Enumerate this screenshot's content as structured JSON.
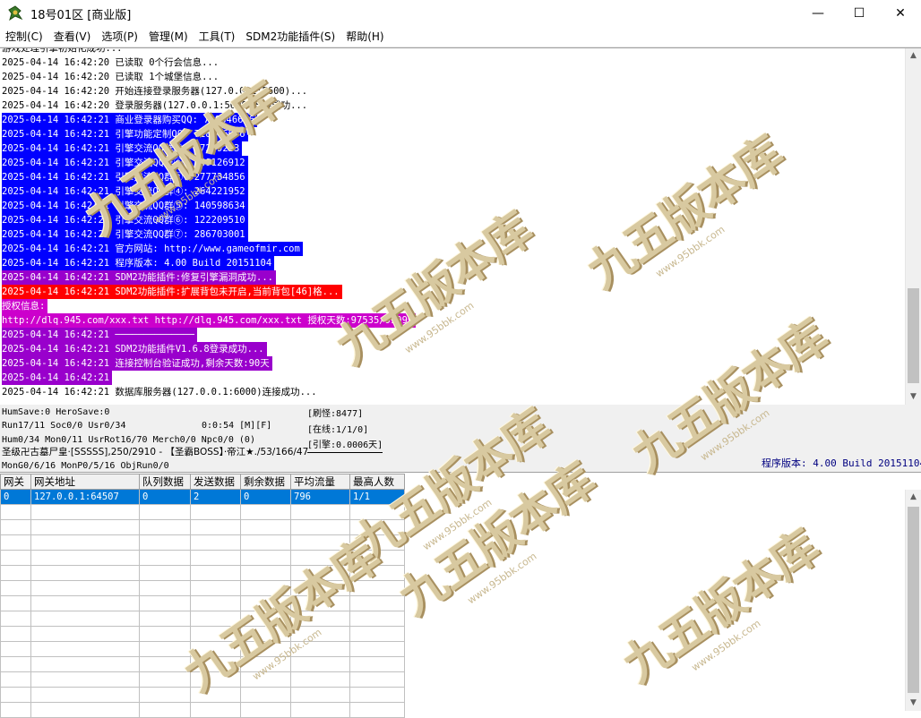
{
  "window": {
    "title": "18号01区 [商业版]",
    "controls": {
      "minimize": "—",
      "maximize": "☐",
      "close": "✕"
    }
  },
  "menu": [
    "控制(C)",
    "查看(V)",
    "选项(P)",
    "管理(M)",
    "工具(T)",
    "SDM2功能插件(S)",
    "帮助(H)"
  ],
  "log": {
    "lines": [
      {
        "text": "游戏处理引擎初始化成功...",
        "bg": ""
      },
      {
        "text": "2025-04-14 16:42:20 已读取 0个行会信息...",
        "bg": ""
      },
      {
        "text": "2025-04-14 16:42:20 已读取 1个城堡信息...",
        "bg": ""
      },
      {
        "text": "2025-04-14 16:42:20 开始连接登录服务器(127.0.0.1:5600)...",
        "bg": ""
      },
      {
        "text": "2025-04-14 16:42:20 登录服务器(127.0.0.1:5600)连接成功...",
        "bg": ""
      },
      {
        "text": "2025-04-14 16:42:21 商业登录器购买QQ: 718846686",
        "bg": "#0000ff"
      },
      {
        "text": "2025-04-14 16:42:21 引擎功能定制QQ: 718846686",
        "bg": "#0000ff"
      },
      {
        "text": "2025-04-14 16:42:21 引擎交流QQ群①: 27299223",
        "bg": "#0000ff"
      },
      {
        "text": "2025-04-14 16:42:21 引擎交流QQ群②: 249126912",
        "bg": "#0000ff"
      },
      {
        "text": "2025-04-14 16:42:21 引擎交流QQ群③: 277734856",
        "bg": "#0000ff"
      },
      {
        "text": "2025-04-14 16:42:21 引擎交流QQ群④: 264221952",
        "bg": "#0000ff"
      },
      {
        "text": "2025-04-14 16:42:21 引擎交流QQ群⑤: 140598634",
        "bg": "#0000ff"
      },
      {
        "text": "2025-04-14 16:42:21 引擎交流QQ群⑥: 122209510",
        "bg": "#0000ff"
      },
      {
        "text": "2025-04-14 16:42:21 引擎交流QQ群⑦: 286703001",
        "bg": "#0000ff"
      },
      {
        "text": "2025-04-14 16:42:21 官方网站: http://www.gameofmir.com",
        "bg": "#0000ff"
      },
      {
        "text": "2025-04-14 16:42:21 程序版本: 4.00 Build 20151104",
        "bg": "#0000ff"
      },
      {
        "text": "2025-04-14 16:42:21 SDM2功能插件:修复引擎漏洞成功...",
        "bg": "#9900cc"
      },
      {
        "text": "2025-04-14 16:42:21 SDM2功能插件:扩展背包未开启,当前背包[46]格...",
        "bg": "#ff0000"
      },
      {
        "text": "授权信息:",
        "bg": "#cc00cc"
      },
      {
        "text": "http://dlq.945.com/xxx.txt http://dlq.945.com/xxx.txt 授权天数:97535/99999",
        "bg": "#cc00cc"
      },
      {
        "text": "2025-04-14 16:42:21 ──────────────",
        "bg": "#9900cc"
      },
      {
        "text": "2025-04-14 16:42:21 SDM2功能插件V1.6.8登录成功...",
        "bg": "#9900cc"
      },
      {
        "text": "2025-04-14 16:42:21 连接控制台验证成功,剩余天数:90天",
        "bg": "#9900cc"
      },
      {
        "text": "2025-04-14 16:42:21",
        "bg": "#9900cc"
      },
      {
        "text": "2025-04-14 16:42:21 数据库服务器(127.0.0.1:6000)连接成功...",
        "bg": ""
      }
    ]
  },
  "status": {
    "line1": "HumSave:0 HeroSave:0",
    "line2": "Run17/11 Soc0/0 Usr0/34",
    "runtime": "0:0:54 [M][F]",
    "monsters": "[刷怪:8477]",
    "online": "[在线:1/1/0]",
    "engine": "[引擎:0.0006天]",
    "line3": "Hum0/34 Mon0/11 UsrRot16/70 Merch0/0 Npc0/0 (0)",
    "line4": "圣级卍古墓尸皇·[SSSSS],250/2910 - 【圣霸BOSS】·帝江★./53/166/47",
    "line5": "MonG0/6/16 MonP0/5/16 ObjRun0/0",
    "build": "程序版本: 4.00 Build 20151104"
  },
  "grid": {
    "headers": [
      "网关",
      "网关地址",
      "队列数据",
      "发送数据",
      "剩余数据",
      "平均流量",
      "最高人数"
    ],
    "rows": [
      [
        "0",
        "127.0.0.1:64507",
        "0",
        "2",
        "0",
        "796",
        "1/1"
      ]
    ],
    "empty_rows": 14
  },
  "watermark": {
    "text": "九五版本库",
    "sub": "www.95bbk.com"
  },
  "colors": {
    "selection": "#0078d7",
    "blue_hl": "#0000ff",
    "purple_hl": "#9900cc",
    "red_hl": "#ff0000",
    "magenta_hl": "#cc00cc"
  }
}
